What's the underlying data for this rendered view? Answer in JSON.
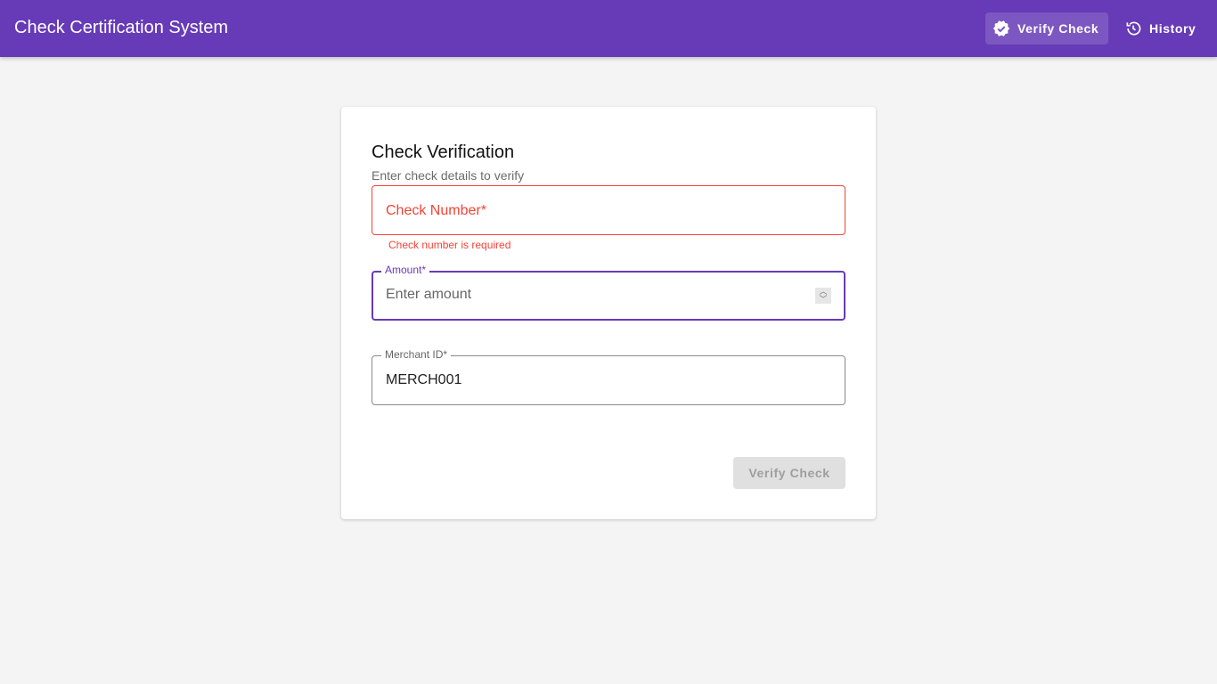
{
  "app": {
    "title": "Check Certification System"
  },
  "nav": {
    "verify": "Verify Check",
    "history": "History"
  },
  "form": {
    "title": "Check Verification",
    "subtitle": "Enter check details to verify",
    "check_number": {
      "label": "Check Number*",
      "error": "Check number is required"
    },
    "amount": {
      "label": "Amount*",
      "placeholder": "Enter amount"
    },
    "merchant": {
      "label": "Merchant ID*",
      "value": "MERCH001"
    },
    "submit": "Verify Check"
  },
  "colors": {
    "primary": "#673ab7",
    "error": "#f44336"
  }
}
